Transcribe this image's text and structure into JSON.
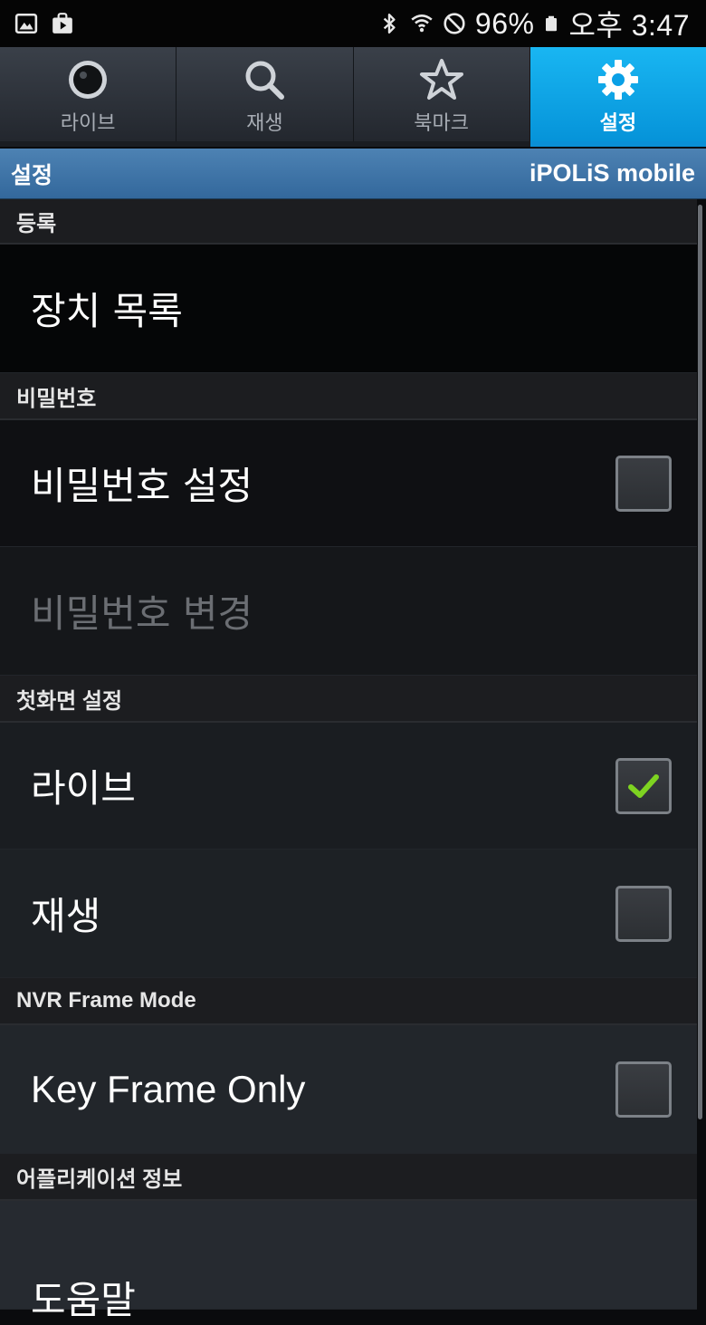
{
  "status_bar": {
    "battery": "96%",
    "time": "오후 3:47",
    "icons": [
      "gallery-icon",
      "store-bag-icon",
      "bluetooth-icon",
      "wifi-icon",
      "do-not-disturb-icon",
      "battery-icon"
    ]
  },
  "tabs": [
    {
      "label": "라이브",
      "icon": "live-icon",
      "active": false
    },
    {
      "label": "재생",
      "icon": "search-icon",
      "active": false
    },
    {
      "label": "북마크",
      "icon": "star-icon",
      "active": false
    },
    {
      "label": "설정",
      "icon": "gear-icon",
      "active": true
    }
  ],
  "title_bar": {
    "title": "설정",
    "app_name": "iPOLiS mobile"
  },
  "sections": [
    {
      "header": "등록",
      "items": [
        {
          "label": "장치 목록",
          "checkbox": null,
          "disabled": false
        }
      ]
    },
    {
      "header": "비밀번호",
      "items": [
        {
          "label": "비밀번호 설정",
          "checkbox": false,
          "disabled": false
        },
        {
          "label": "비밀번호 변경",
          "checkbox": null,
          "disabled": true
        }
      ]
    },
    {
      "header": "첫화면 설정",
      "items": [
        {
          "label": "라이브",
          "checkbox": true,
          "disabled": false
        },
        {
          "label": "재생",
          "checkbox": false,
          "disabled": false
        }
      ]
    },
    {
      "header": "NVR Frame Mode",
      "items": [
        {
          "label": "Key Frame Only",
          "checkbox": false,
          "disabled": false
        }
      ]
    },
    {
      "header": "어플리케이션 정보",
      "items": [
        {
          "label": "도움말",
          "checkbox": null,
          "disabled": false
        }
      ]
    }
  ],
  "colors": {
    "accent": "#0a9fe6",
    "title_bar": "#3f76a8",
    "check_green": "#7ed321"
  }
}
